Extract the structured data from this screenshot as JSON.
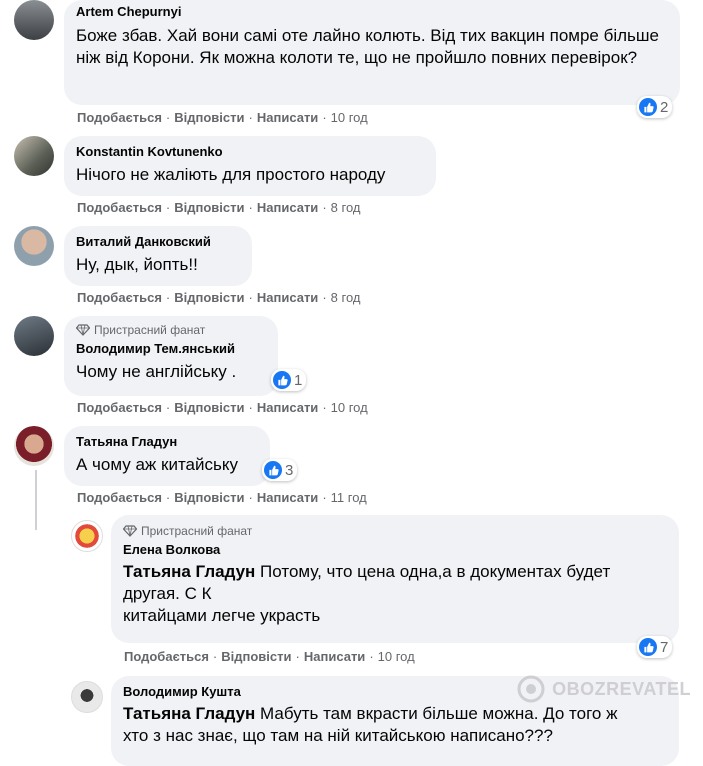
{
  "action_labels": {
    "like": "Подобається",
    "reply": "Відповісти",
    "message": "Написати",
    "sep": "·"
  },
  "comments": [
    {
      "author": "Artem Chepurnyi",
      "text": "Боже збав. Хай вони самі оте лайно колють. Від тих вакцин помре більше ніж від Корони. Як можна колоти те, що не пройшло повних перевірок?",
      "time": "10 год",
      "reactions": "2"
    },
    {
      "author": "Konstantin Kovtunenko",
      "text": "Нічого не жаліють для простого народу",
      "time": "8 год"
    },
    {
      "author": "Виталий Данковский",
      "text": "Ну, дык, йопть!!",
      "time": "8 год"
    },
    {
      "badge": "Пристрасний фанат",
      "author": "Володимир Тем.янський",
      "text": "Чому не англійську .",
      "time": "10 год",
      "reactions": "1"
    },
    {
      "author": "Татьяна Гладун",
      "text": "А чому аж китайську",
      "time": "11 год",
      "reactions": "3"
    }
  ],
  "replies": [
    {
      "badge": "Пристрасний фанат",
      "author": "Елена Волкова",
      "mention": "Татьяна Гладун",
      "line1": " Потому, что цена одна,а в документах будет",
      "line2": "другая. С К",
      "line3": "китайцами легче украсть",
      "time": "10 год",
      "reactions": "7"
    },
    {
      "author": "Володимир Кушта",
      "mention": "Татьяна Гладун",
      "line1": " Мабуть там вкрасти більше можна. До того ж",
      "line2": "хто з нас знає, що там на ній китайською написано???"
    }
  ],
  "watermark": "OBOZREVATEL",
  "colors": {
    "like_blue": "#1877f2",
    "bubble": "#f0f2f5",
    "meta": "#65676b"
  }
}
